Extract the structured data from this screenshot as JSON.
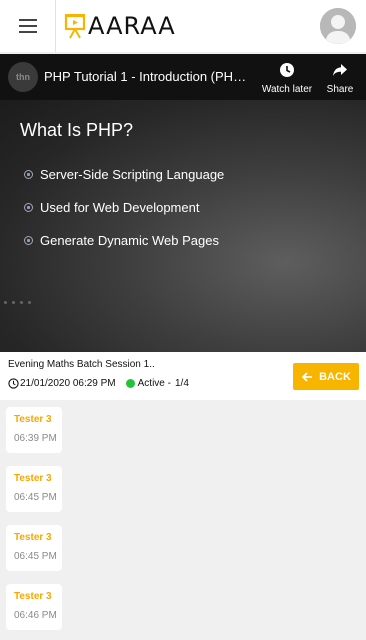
{
  "header": {
    "logo_text": "AARAA",
    "menu_icon": "hamburger-menu-icon",
    "avatar_icon": "user-avatar-icon",
    "brand_color": "#f7b500"
  },
  "video": {
    "title": "PHP Tutorial 1 - Introduction (PHP ...",
    "watch_later_label": "Watch later",
    "share_label": "Share",
    "slide": {
      "heading": "What Is PHP?",
      "bullets": [
        "Server-Side Scripting Language",
        "Used for Web Development",
        "Generate Dynamic Web Pages"
      ]
    }
  },
  "session": {
    "title": "Evening Maths Batch Session 1..",
    "datetime": "21/01/2020 06:29 PM",
    "status": "Active -",
    "count": "1/4",
    "status_color": "#22c33a",
    "back_label": "BACK"
  },
  "messages": [
    {
      "name": "Tester 3",
      "time": "06:39 PM"
    },
    {
      "name": "Tester 3",
      "time": "06:45 PM"
    },
    {
      "name": "Tester 3",
      "time": "06:45 PM"
    },
    {
      "name": "Tester 3",
      "time": "06:46 PM"
    }
  ]
}
